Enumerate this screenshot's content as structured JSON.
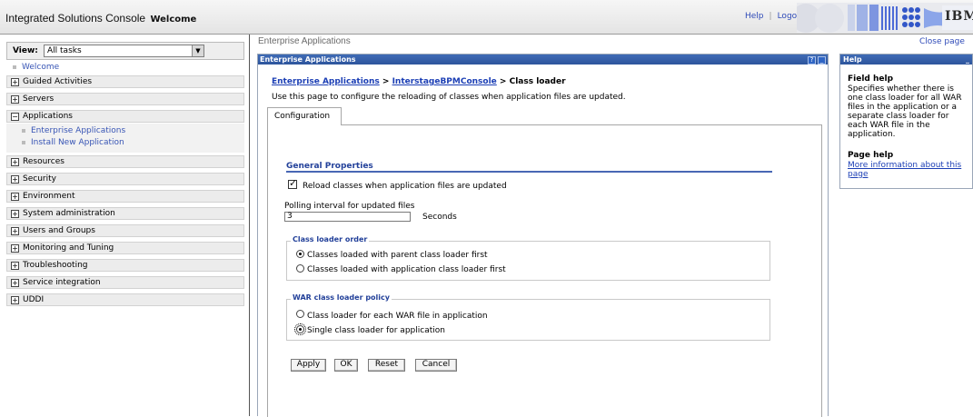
{
  "banner": {
    "title": "Integrated Solutions Console",
    "welcome": "Welcome",
    "help_link": "Help",
    "logout_link": "Logout",
    "brand": "IBM."
  },
  "nav": {
    "view_label": "View:",
    "view_value": "All tasks",
    "welcome": "Welcome",
    "items": [
      {
        "label": "Guided Activities",
        "expanded": false
      },
      {
        "label": "Servers",
        "expanded": false
      },
      {
        "label": "Applications",
        "expanded": true,
        "children": [
          "Enterprise Applications",
          "Install New Application"
        ]
      },
      {
        "label": "Resources",
        "expanded": false
      },
      {
        "label": "Security",
        "expanded": false
      },
      {
        "label": "Environment",
        "expanded": false
      },
      {
        "label": "System administration",
        "expanded": false
      },
      {
        "label": "Users and Groups",
        "expanded": false
      },
      {
        "label": "Monitoring and Tuning",
        "expanded": false
      },
      {
        "label": "Troubleshooting",
        "expanded": false
      },
      {
        "label": "Service integration",
        "expanded": false
      },
      {
        "label": "UDDI",
        "expanded": false
      }
    ]
  },
  "content": {
    "page_heading": "Enterprise Applications",
    "close_page": "Close page",
    "portlet_title": "Enterprise Applications",
    "portlet_controls": [
      "?",
      "_"
    ],
    "breadcrumb": {
      "link1": "Enterprise Applications",
      "sep": ">",
      "link2": "InterstageBPMConsole",
      "current": "Class loader"
    },
    "description": "Use this page to configure the reloading of classes when application files are updated.",
    "tab": "Configuration",
    "general_properties": "General Properties",
    "reload_checkbox": {
      "label": "Reload classes when application files are updated",
      "checked": true
    },
    "polling": {
      "label": "Polling interval for updated files",
      "value": "3",
      "unit": "Seconds"
    },
    "class_loader_order": {
      "legend": "Class loader order",
      "options": [
        {
          "label": "Classes loaded with parent class loader first",
          "selected": true
        },
        {
          "label": "Classes loaded with application class loader first",
          "selected": false
        }
      ]
    },
    "war_policy": {
      "legend": "WAR class loader policy",
      "options": [
        {
          "label": "Class loader for each WAR file in application",
          "selected": false
        },
        {
          "label": "Single class loader for application",
          "selected": true
        }
      ]
    },
    "buttons": {
      "apply": "Apply",
      "ok": "OK",
      "reset": "Reset",
      "cancel": "Cancel"
    }
  },
  "help": {
    "title": "Help",
    "control": "_",
    "field_help_title": "Field help",
    "field_help_text": "Specifies whether there is one class loader for all WAR files in the application or a separate class loader for each WAR file in the application.",
    "page_help_title": "Page help",
    "page_help_link": "More information about this page"
  },
  "colors": {
    "portlet_bar": "#2e559d",
    "link": "#1c3fb5",
    "section_rule": "#4867b4"
  }
}
